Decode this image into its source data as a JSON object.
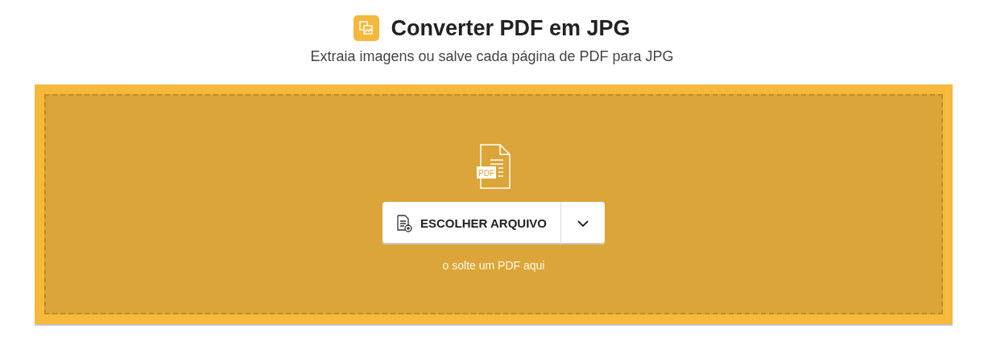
{
  "header": {
    "title": "Converter PDF em JPG",
    "subtitle": "Extraia imagens ou salve cada página de PDF para JPG"
  },
  "dropzone": {
    "file_badge": "PDF",
    "button": "ESCOLHER ARQUIVO",
    "hint": "o solte um PDF aqui"
  }
}
